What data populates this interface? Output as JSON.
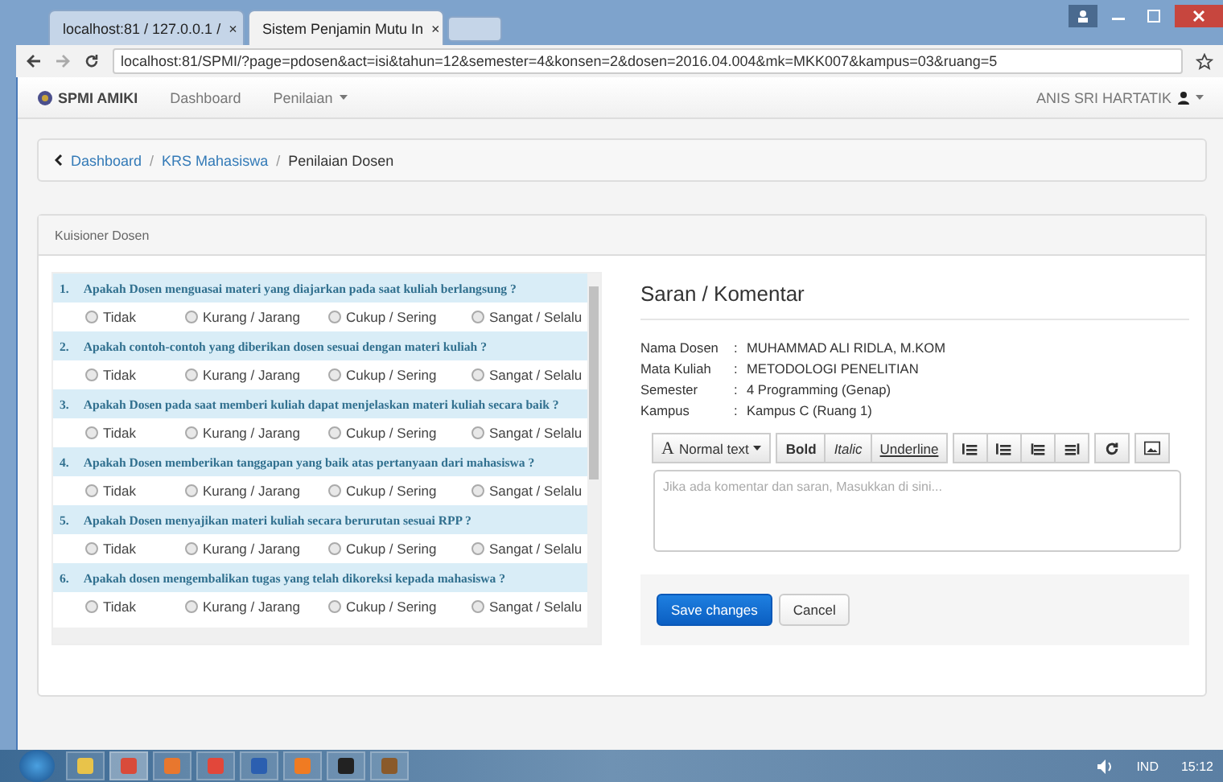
{
  "browser": {
    "tabs": [
      {
        "label": "localhost:81 / 127.0.0.1 /",
        "close": "×",
        "selected": false
      },
      {
        "label": "Sistem Penjamin Mutu In",
        "close": "×",
        "selected": true
      }
    ],
    "address": "localhost:81/SPMI/?page=pdosen&act=isi&tahun=12&semester=4&konsen=2&dosen=2016.04.004&mk=MKK007&kampus=03&ruang=5"
  },
  "navbar": {
    "brand": "SPMI AMIKI",
    "links": [
      {
        "label": "Dashboard",
        "dropdown": false
      },
      {
        "label": "Penilaian",
        "dropdown": true
      }
    ],
    "user": "ANIS SRI HARTATIK"
  },
  "breadcrumb": [
    {
      "label": "Dashboard",
      "link": true
    },
    {
      "separator": "/",
      "label": "KRS Mahasiswa",
      "link": true
    },
    {
      "separator": "/",
      "label": "Penilaian Dosen",
      "link": false
    }
  ],
  "panel": {
    "title": "Kuisioner Dosen"
  },
  "questions": [
    {
      "number": "1.",
      "text": "Apakah Dosen menguasai materi yang diajarkan pada saat kuliah berlangsung ?",
      "options": [
        {
          "label": "Tidak",
          "selected": false
        },
        {
          "label": "Kurang / Jarang",
          "selected": false
        },
        {
          "label": "Cukup / Sering",
          "selected": false
        },
        {
          "label": "Sangat / Selalu",
          "selected": false
        }
      ]
    },
    {
      "number": "2.",
      "text": "Apakah contoh-contoh yang diberikan dosen sesuai dengan materi kuliah ?",
      "options": [
        {
          "label": "Tidak",
          "selected": false
        },
        {
          "label": "Kurang / Jarang",
          "selected": false
        },
        {
          "label": "Cukup / Sering",
          "selected": false
        },
        {
          "label": "Sangat / Selalu",
          "selected": false
        }
      ]
    },
    {
      "number": "3.",
      "text": "Apakah Dosen pada saat memberi kuliah dapat menjelaskan materi kuliah secara baik ?",
      "options": [
        {
          "label": "Tidak",
          "selected": false
        },
        {
          "label": "Kurang / Jarang",
          "selected": false
        },
        {
          "label": "Cukup / Sering",
          "selected": false
        },
        {
          "label": "Sangat / Selalu",
          "selected": false
        }
      ]
    },
    {
      "number": "4.",
      "text": "Apakah Dosen memberikan tanggapan yang baik atas pertanyaan dari mahasiswa ?",
      "options": [
        {
          "label": "Tidak",
          "selected": false
        },
        {
          "label": "Kurang / Jarang",
          "selected": false
        },
        {
          "label": "Cukup / Sering",
          "selected": false
        },
        {
          "label": "Sangat / Selalu",
          "selected": false
        }
      ]
    },
    {
      "number": "5.",
      "text": "Apakah Dosen menyajikan materi kuliah secara berurutan sesuai RPP ?",
      "options": [
        {
          "label": "Tidak",
          "selected": false
        },
        {
          "label": "Kurang / Jarang",
          "selected": false
        },
        {
          "label": "Cukup / Sering",
          "selected": false
        },
        {
          "label": "Sangat / Selalu",
          "selected": false
        }
      ]
    },
    {
      "number": "6.",
      "text": "Apakah dosen mengembalikan tugas yang telah dikoreksi kepada mahasiswa ?",
      "options": [
        {
          "label": "Tidak",
          "selected": false
        },
        {
          "label": "Kurang / Jarang",
          "selected": false
        },
        {
          "label": "Cukup / Sering",
          "selected": false
        },
        {
          "label": "Sangat / Selalu",
          "selected": false
        }
      ]
    }
  ],
  "comment": {
    "title": "Saran / Komentar",
    "details": [
      {
        "label": "Nama Dosen",
        "separator": ":",
        "value": "MUHAMMAD ALI RIDLA, M.KOM"
      },
      {
        "label": "Mata Kuliah",
        "separator": ":",
        "value": "METODOLOGI PENELITIAN"
      },
      {
        "label": "Semester",
        "separator": ":",
        "value": "4 Programming (Genap)"
      },
      {
        "label": "Kampus",
        "separator": ":",
        "value": "Kampus C (Ruang 1)"
      }
    ],
    "toolbar": [
      {
        "kind": "dropdown",
        "glyph": "A",
        "label": "Normal text"
      },
      {
        "kind": "bold",
        "label": "Bold"
      },
      {
        "kind": "italic",
        "label": "Italic"
      },
      {
        "kind": "underline",
        "label": "Underline"
      },
      {
        "kind": "bullets"
      },
      {
        "kind": "numbers"
      },
      {
        "kind": "outdent"
      },
      {
        "kind": "indent"
      },
      {
        "kind": "refresh"
      },
      {
        "kind": "image"
      }
    ],
    "placeholder": "Jika ada komentar dan saran, Masukkan di sini...",
    "buttons": [
      {
        "label": "Save changes",
        "primary": true
      },
      {
        "label": "Cancel",
        "primary": false
      }
    ]
  },
  "taskbar": {
    "apps": [
      {
        "kind": "folder",
        "selected": false
      },
      {
        "kind": "chrome",
        "selected": true
      },
      {
        "kind": "firefox",
        "selected": false
      },
      {
        "kind": "pdf",
        "selected": false
      },
      {
        "kind": "word",
        "selected": false
      },
      {
        "kind": "xampp",
        "selected": false
      },
      {
        "kind": "terminal",
        "selected": false
      },
      {
        "kind": "archive",
        "selected": false
      }
    ],
    "language": "IND",
    "time": "15:12"
  }
}
